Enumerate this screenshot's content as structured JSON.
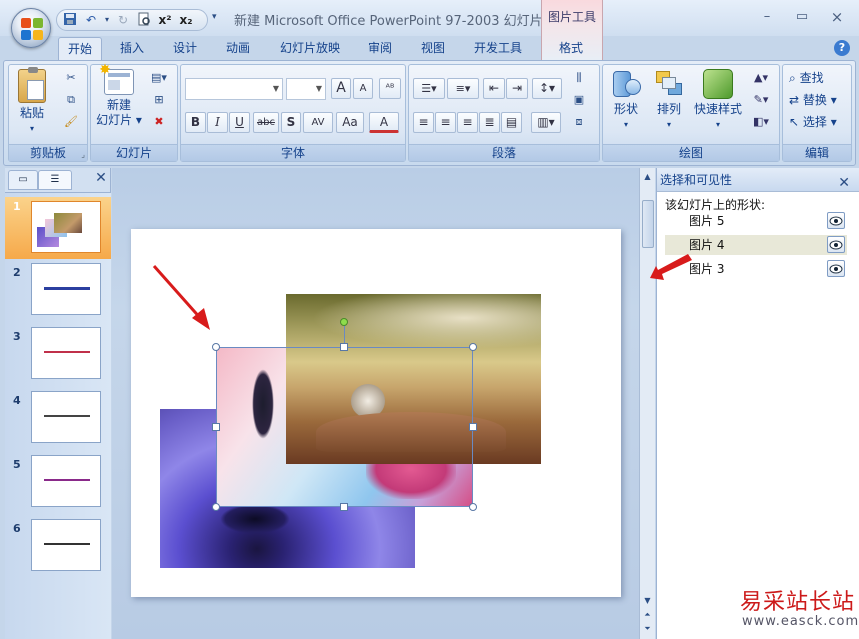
{
  "window": {
    "title": "新建 Microsoft Office PowerPoint 97-2003 幻灯片...",
    "context_tab": "图片工具",
    "minimize": "–",
    "restore": "▭",
    "close": "×"
  },
  "quick_access": {
    "icons": [
      "save-icon",
      "undo-icon",
      "redo-icon",
      "print-preview-icon",
      "superscript-icon",
      "subscript-icon",
      "customize-icon"
    ],
    "superscript": "x²",
    "subscript": "x₂"
  },
  "tabs": [
    {
      "label": "开始",
      "active": true
    },
    {
      "label": "插入"
    },
    {
      "label": "设计"
    },
    {
      "label": "动画"
    },
    {
      "label": "幻灯片放映"
    },
    {
      "label": "审阅"
    },
    {
      "label": "视图"
    },
    {
      "label": "开发工具"
    },
    {
      "label": "格式"
    }
  ],
  "ribbon": {
    "clipboard": {
      "group": "剪贴板",
      "paste": "粘贴"
    },
    "slides": {
      "group": "幻灯片",
      "new_slide": "新建\n幻灯片"
    },
    "font": {
      "group": "字体",
      "font_name": "",
      "font_size": "",
      "bold": "B",
      "italic": "I",
      "underline": "U",
      "strike": "abc",
      "shadow": "S",
      "spacing": "AV",
      "case": "Aa",
      "color": "A",
      "grow": "A",
      "shrink": "A"
    },
    "paragraph": {
      "group": "段落"
    },
    "drawing": {
      "group": "绘图",
      "shapes": "形状",
      "arrange": "排列",
      "quick_styles": "快速样式"
    },
    "editing": {
      "group": "编辑",
      "find": "查找",
      "replace": "替换",
      "select": "选择"
    }
  },
  "thumbnails": [
    {
      "number": "1",
      "selected": true
    },
    {
      "number": "2"
    },
    {
      "number": "3"
    },
    {
      "number": "4"
    },
    {
      "number": "5"
    },
    {
      "number": "6"
    }
  ],
  "selection_pane": {
    "title": "选择和可见性",
    "subtitle": "该幻灯片上的形状:",
    "shapes": [
      {
        "name": "图片 5",
        "highlighted": false
      },
      {
        "name": "图片 4",
        "highlighted": true
      },
      {
        "name": "图片 3",
        "highlighted": false
      }
    ]
  },
  "watermark": {
    "brand": "易采站长站",
    "url": "www.easck.com"
  },
  "colors": {
    "accent": "#15428b",
    "arrow": "#d81b1b",
    "selected_thumb": "#f6a94a"
  }
}
